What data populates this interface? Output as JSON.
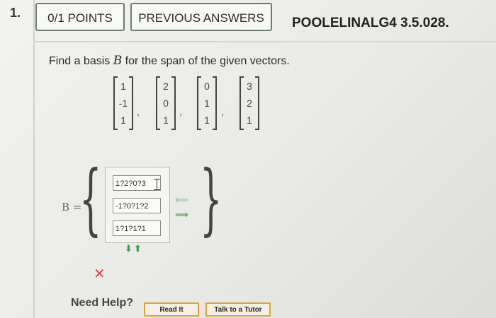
{
  "question": {
    "number": "1.",
    "points": "0/1 POINTS",
    "previous_answers": "PREVIOUS ANSWERS",
    "id": "POOLELINALG4 3.5.028."
  },
  "prompt": {
    "before": "Find a basis ",
    "symbol": "B",
    "after": " for the span of the given vectors."
  },
  "vectors": [
    [
      "1",
      "-1",
      "1"
    ],
    [
      "2",
      "0",
      "1"
    ],
    [
      "0",
      "1",
      "1"
    ],
    [
      "3",
      "2",
      "1"
    ]
  ],
  "answer": {
    "label": "B =",
    "entries": [
      "1?2?0?3",
      "-1?0?1?2",
      "1?1?1?1"
    ],
    "move_arrows": "⬇⬆",
    "left_arrow": "⟸",
    "right_arrow": "⟹",
    "result_mark": "✕"
  },
  "help": {
    "label": "Need Help?",
    "read_it": "Read It",
    "talk_to_tutor": "Talk to a Tutor"
  },
  "colors": {
    "correct_green": "#2f9b46",
    "wrong_red": "#d84a3c",
    "button_border": "#d9a63a"
  }
}
